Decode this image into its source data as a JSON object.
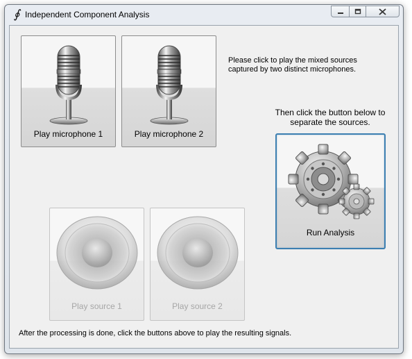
{
  "window": {
    "title": "Independent Component Analysis",
    "app_icon": "integral-icon",
    "controls": [
      "minimize-icon",
      "maximize-icon",
      "close-icon"
    ]
  },
  "instructions": {
    "play_mixed_line1": "Please click to play the mixed sources",
    "play_mixed_line2": "captured by two distinct microphones.",
    "separate_line1": "Then click the button below to",
    "separate_line2": "separate the sources.",
    "footer": "After the processing is done, click the buttons above to play the resulting signals."
  },
  "buttons": {
    "mic1": {
      "label": "Play microphone 1",
      "icon": "microphone-icon",
      "enabled": true
    },
    "mic2": {
      "label": "Play microphone 2",
      "icon": "microphone-icon",
      "enabled": true
    },
    "run": {
      "label": "Run Analysis",
      "icon": "gears-icon",
      "enabled": true
    },
    "source1": {
      "label": "Play source 1",
      "icon": "speaker-icon",
      "enabled": false
    },
    "source2": {
      "label": "Play source 2",
      "icon": "speaker-icon",
      "enabled": false
    }
  },
  "colors": {
    "focus_border": "#3c7fb1",
    "disabled_text": "#a6a6a6"
  }
}
